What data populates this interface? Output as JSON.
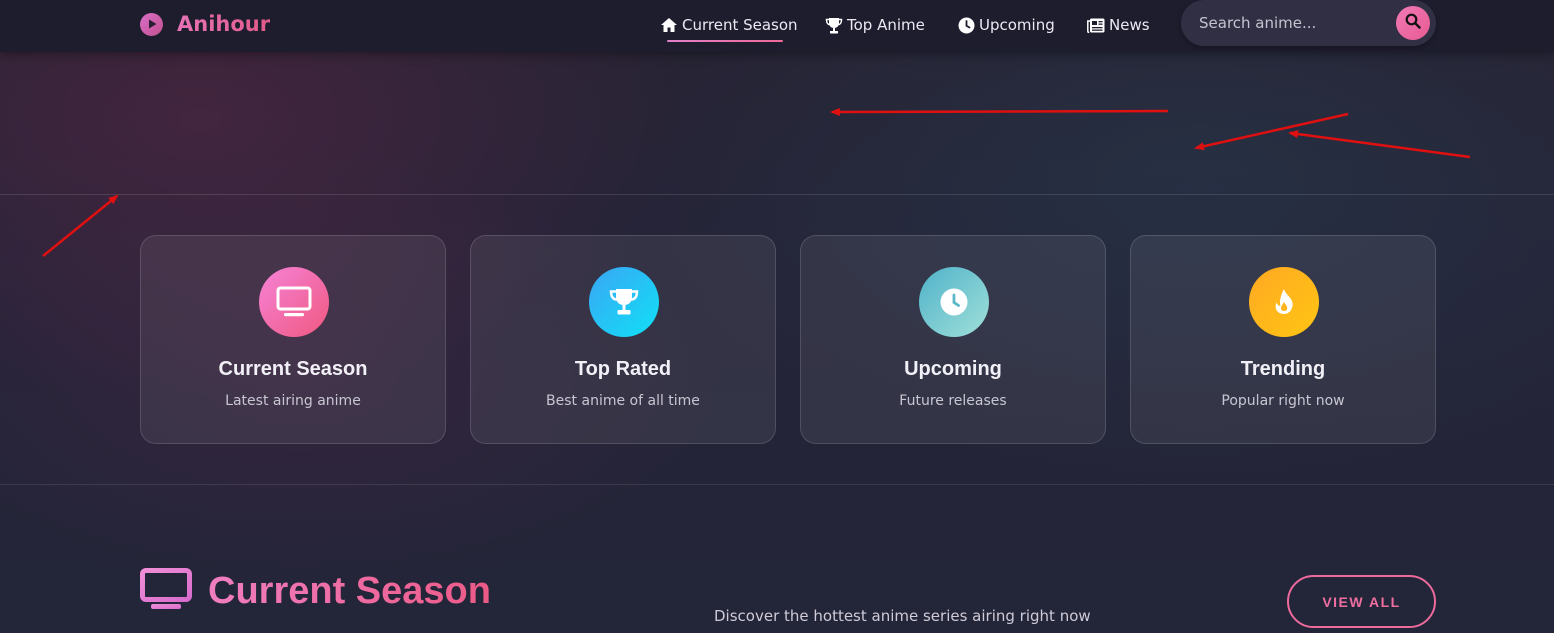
{
  "app": {
    "name": "Anihour"
  },
  "nav": {
    "links": [
      {
        "label": "Current Season",
        "icon": "home-icon",
        "active": true
      },
      {
        "label": "Top Anime",
        "icon": "trophy-icon",
        "active": false
      },
      {
        "label": "Upcoming",
        "icon": "clock-icon",
        "active": false
      },
      {
        "label": "News",
        "icon": "newspaper-icon",
        "active": false
      }
    ],
    "search_placeholder": "Search anime..."
  },
  "cards": [
    {
      "title": "Current Season",
      "subtitle": "Latest airing anime",
      "icon": "tv-icon",
      "color": "#f0609a"
    },
    {
      "title": "Top Rated",
      "subtitle": "Best anime of all time",
      "icon": "trophy-icon",
      "color": "#22c8f5"
    },
    {
      "title": "Upcoming",
      "subtitle": "Future releases",
      "icon": "clock-icon",
      "color": "#66c4cf"
    },
    {
      "title": "Trending",
      "subtitle": "Popular right now",
      "icon": "fire-icon",
      "color": "#ffb520"
    }
  ],
  "section": {
    "title": "Current Season",
    "description": "Discover the hottest anime series airing right now",
    "view_all": "VIEW ALL"
  },
  "colors": {
    "accent_pink": "#ec5a8e",
    "annotation_arrow": "#e01010"
  }
}
